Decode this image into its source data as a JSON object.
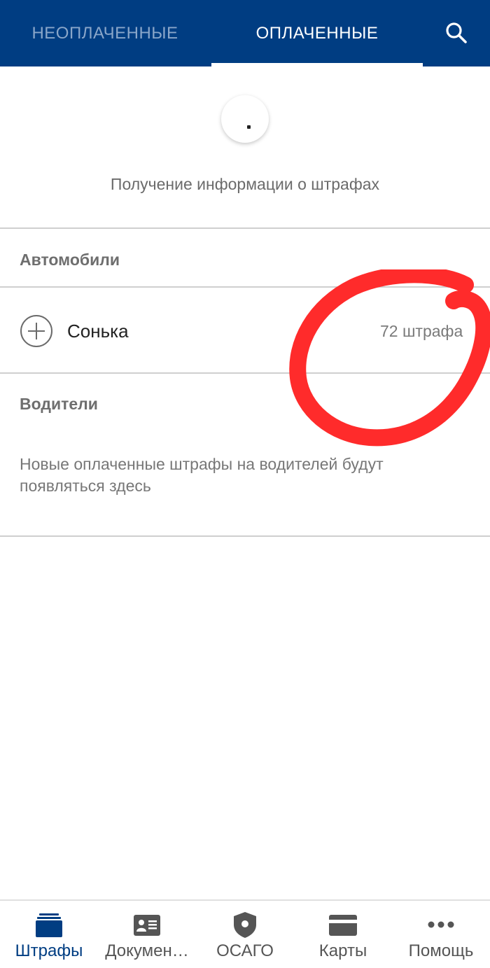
{
  "header": {
    "tabs": [
      {
        "label": "НЕОПЛАЧЕННЫЕ",
        "active": false
      },
      {
        "label": "ОПЛАЧЕННЫЕ",
        "active": true
      }
    ],
    "search_icon": "search-icon",
    "background_color": "#003d82"
  },
  "status": {
    "loading_text": "Получение информации о штрафах"
  },
  "cars": {
    "title": "Автомобили",
    "items": [
      {
        "name": "Сонька",
        "count": "72 штрафа",
        "icon": "plus-circle-icon"
      }
    ]
  },
  "drivers": {
    "title": "Водители",
    "empty_text": "Новые оплаченные штрафы на водителей будут появляться здесь"
  },
  "annotation": {
    "color": "#ff2b2b",
    "shape": "hand-drawn-circle"
  },
  "bottom_nav": {
    "items": [
      {
        "label": "Штрафы",
        "icon": "fines-icon",
        "active": true
      },
      {
        "label": "Докумен…",
        "icon": "documents-icon",
        "active": false
      },
      {
        "label": "ОСАГО",
        "icon": "shield-icon",
        "active": false
      },
      {
        "label": "Карты",
        "icon": "card-icon",
        "active": false
      },
      {
        "label": "Помощь",
        "icon": "more-icon",
        "active": false
      }
    ],
    "active_color": "#003d82"
  }
}
